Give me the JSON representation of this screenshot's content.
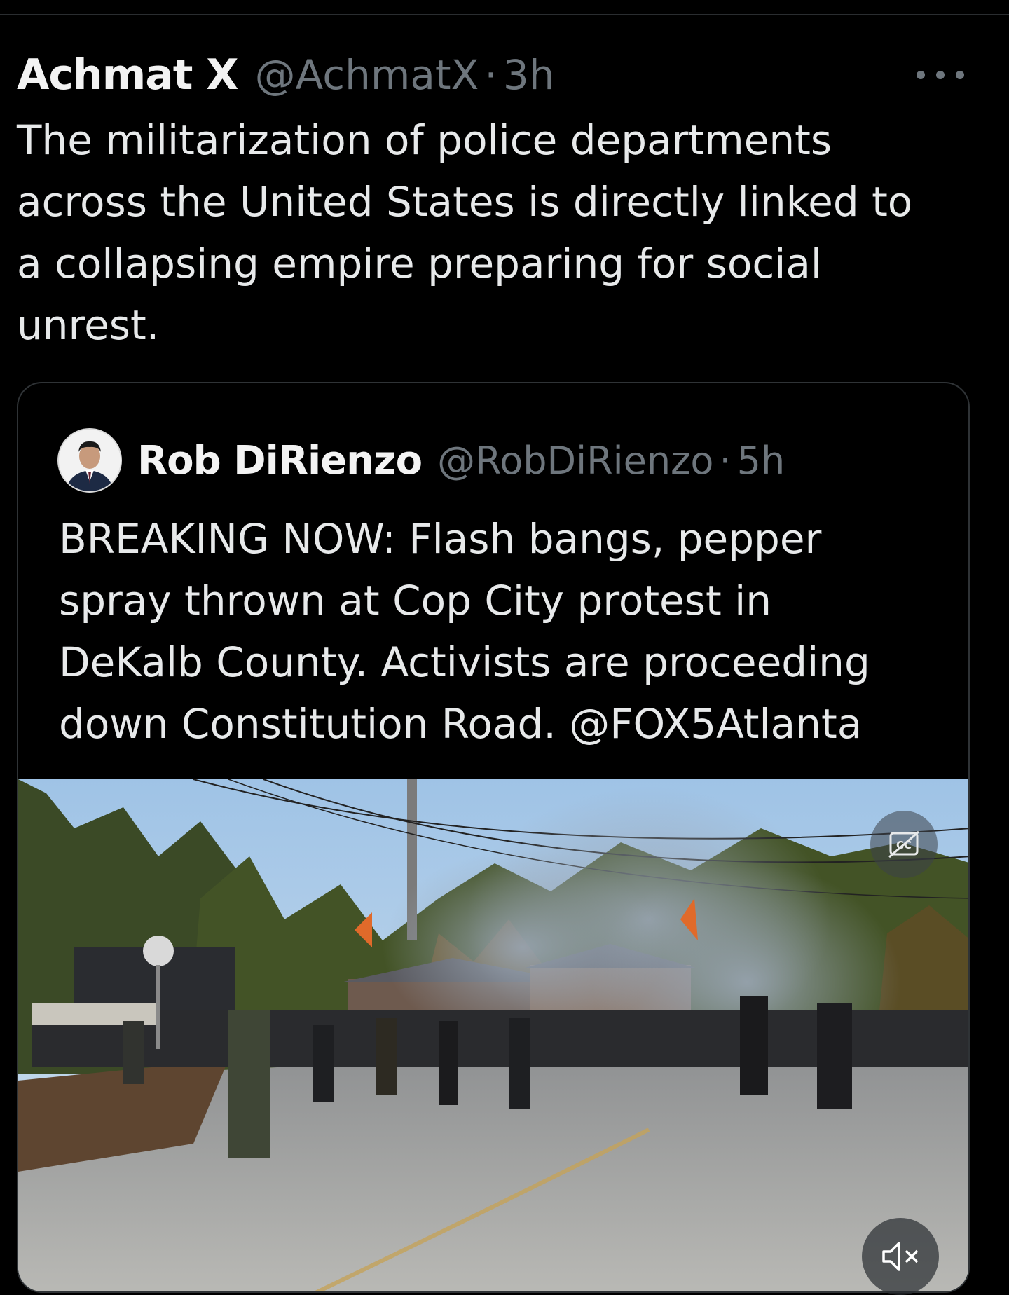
{
  "tweet": {
    "author_name": "Achmat X",
    "author_handle": "@AchmatX",
    "separator": "·",
    "timestamp": "3h",
    "more_icon": "more-horizontal-icon",
    "text": "The militarization of police departments\nacross the United States is directly linked to\na collapsing empire preparing for social\nunrest."
  },
  "quoted_tweet": {
    "author_name": "Rob DiRienzo",
    "author_handle": "@RobDiRienzo",
    "separator": "·",
    "timestamp": "5h",
    "text": "BREAKING NOW: Flash bangs, pepper\nspray thrown at Cop City protest in\nDeKalb County. Activists are proceeding\ndown Constitution Road. @FOX5Atlanta",
    "media": {
      "type": "video",
      "captions_icon": "closed-captions-off-icon",
      "mute_icon": "volume-muted-icon"
    }
  },
  "colors": {
    "background": "#000000",
    "primary_text": "#e7e9ea",
    "secondary_text": "#6e767d",
    "border": "#2f3336"
  }
}
